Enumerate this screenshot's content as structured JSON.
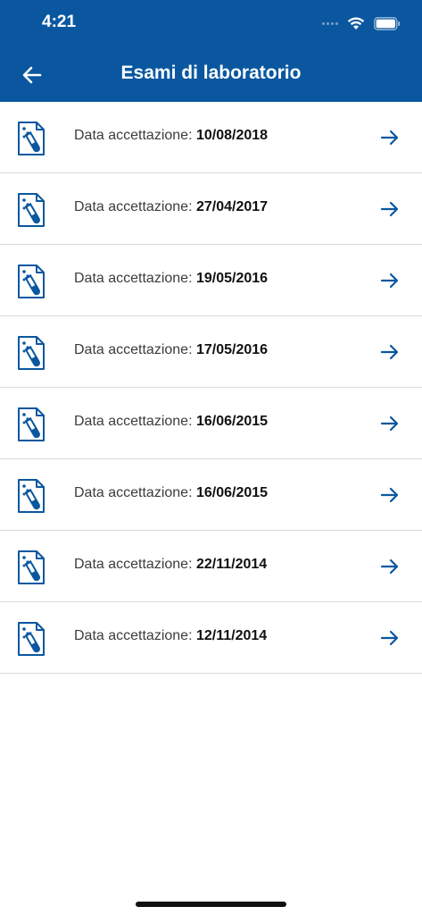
{
  "status_bar": {
    "time": "4:21"
  },
  "header": {
    "title": "Esami di laboratorio",
    "back_icon": "arrow-left-icon"
  },
  "colors": {
    "header_bg": "#0a57a0",
    "accent": "#0a57a0",
    "divider": "#d9d9d9"
  },
  "list": {
    "items": [
      {
        "label": "Data accettazione: ",
        "date": "10/08/2018"
      },
      {
        "label": "Data accettazione: ",
        "date": "27/04/2017"
      },
      {
        "label": "Data accettazione: ",
        "date": "19/05/2016"
      },
      {
        "label": "Data accettazione: ",
        "date": "17/05/2016"
      },
      {
        "label": "Data accettazione: ",
        "date": "16/06/2015"
      },
      {
        "label": "Data accettazione: ",
        "date": "16/06/2015"
      },
      {
        "label": "Data accettazione: ",
        "date": "22/11/2014"
      },
      {
        "label": "Data accettazione: ",
        "date": "12/11/2014"
      }
    ]
  }
}
